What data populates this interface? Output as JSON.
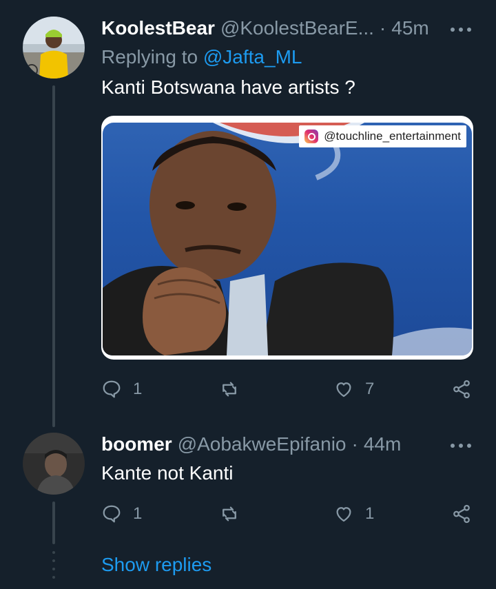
{
  "tweets": [
    {
      "display_name": "KoolestBear",
      "handle": "@KoolestBearE...",
      "separator": "·",
      "time": "45m",
      "replying_prefix": "Replying to ",
      "replying_to": "@Jafta_ML",
      "text": "Kanti Botswana have artists ?",
      "media_watermark": "@touchline_entertainment",
      "actions": {
        "replies": "1",
        "retweets": "",
        "likes": "7"
      }
    },
    {
      "display_name": "boomer",
      "handle": "@AobakweEpifanio",
      "separator": "·",
      "time": "44m",
      "text": "Kante not Kanti",
      "actions": {
        "replies": "1",
        "retweets": "",
        "likes": "1"
      }
    }
  ],
  "show_replies": "Show replies",
  "icons": [
    "reply-icon",
    "retweet-icon",
    "like-icon",
    "share-icon",
    "more-icon",
    "instagram-icon"
  ],
  "colors": {
    "background": "#15202b",
    "secondary_text": "#8899a6",
    "link": "#1d9bf0",
    "thread_line": "#38444d"
  }
}
